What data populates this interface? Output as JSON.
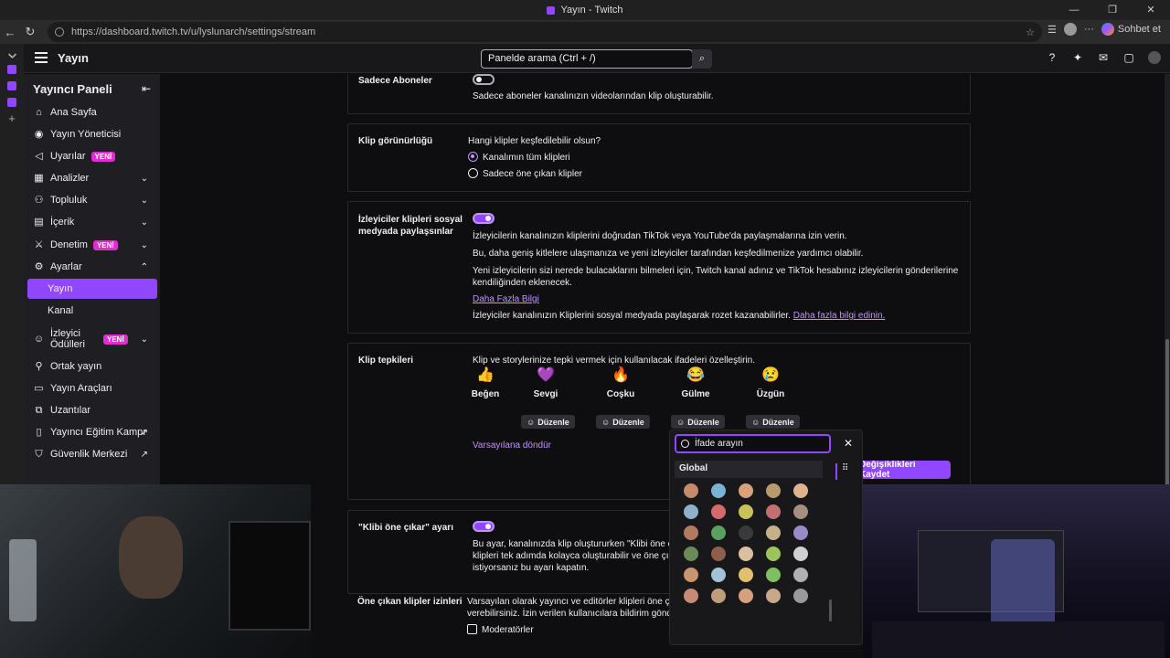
{
  "window": {
    "title": "Yayın - Twitch",
    "url": "https://dashboard.twitch.tv/u/lyslunarch/settings/stream",
    "chat_label": "Sohbet et"
  },
  "header": {
    "title": "Yayın",
    "search_placeholder": "Panelde arama (Ctrl + /)"
  },
  "sidebar": {
    "title": "Yayıncı Paneli",
    "items": [
      {
        "label": "Ana Sayfa"
      },
      {
        "label": "Yayın Yöneticisi"
      },
      {
        "label": "Uyarılar",
        "badge": "YENİ"
      },
      {
        "label": "Analizler"
      },
      {
        "label": "Topluluk"
      },
      {
        "label": "İçerik"
      },
      {
        "label": "Denetim",
        "badge": "YENİ"
      },
      {
        "label": "Ayarlar"
      },
      {
        "label": "Yayın"
      },
      {
        "label": "Kanal"
      },
      {
        "label": "İzleyici Ödülleri",
        "badge": "YENİ"
      },
      {
        "label": "Ortak yayın"
      },
      {
        "label": "Yayın Araçları"
      },
      {
        "label": "Uzantılar"
      },
      {
        "label": "Yayıncı Eğitim Kampı"
      },
      {
        "label": "Güvenlik Merkezi"
      }
    ]
  },
  "settings": {
    "subs": {
      "label": "Sadece Aboneler",
      "desc": "Sadece aboneler kanalınızın videolarından klip oluşturabilir."
    },
    "visibility": {
      "label": "Klip görünürlüğü",
      "question": "Hangi klipler keşfedilebilir olsun?",
      "opt1": "Kanalımın tüm klipleri",
      "opt2": "Sadece öne çıkan klipler"
    },
    "social": {
      "label": "İzleyiciler klipleri sosyal medyada paylaşsınlar",
      "p1": "İzleyicilerin kanalınızın kliplerini doğrudan TikTok veya YouTube'da paylaşmalarına izin verin.",
      "p2": "Bu, daha geniş kitlelere ulaşmanıza ve yeni izleyiciler tarafından keşfedilmenize yardımcı olabilir.",
      "p3a": "Yeni izleyicilerin sizi nerede bulacaklarını bilmeleri için, Twitch kanal adınız ve TikTok hesabınız izleyicilerin gönderilerine",
      "p3b": "kendiliğinden eklenecek.",
      "link": "Daha Fazla Bilgi",
      "p4": "İzleyiciler kanalınızın Kliplerini sosyal medyada paylaşarak rozet kazanabilirler.",
      "p4link": "Daha fazla bilgi edinin."
    },
    "reactions": {
      "label": "Klip tepkileri",
      "desc": "Klip ve storylerinize tepki vermek için kullanılacak ifadeleri özelleştirin.",
      "items": [
        {
          "name": "Beğen",
          "emo": "👍"
        },
        {
          "name": "Sevgi",
          "emo": "💜"
        },
        {
          "name": "Coşku",
          "emo": "🔥"
        },
        {
          "name": "Gülme",
          "emo": "😂"
        },
        {
          "name": "Üzgün",
          "emo": "😢"
        }
      ],
      "edit_label": "Düzenle",
      "reset": "Varsayılana döndür"
    },
    "feature": {
      "label": "\"Klibi öne çıkar\" ayarı",
      "p1": "Bu ayar, kanalınızda klip oluştururken \"Klibi öne ç",
      "p2": "klipleri tek adımda kolayca oluşturabilir ve öne çık",
      "p3": "istiyorsanız bu ayarı kapatın."
    },
    "perms": {
      "label": "Öne çıkan klipler izinleri",
      "p1": "Varsayılan olarak yayıncı ve editörler klipleri öne ç",
      "p2": "verebilirsiniz. İzin verilen kullanıcılara bildirim gönd",
      "opt": "Moderatörler"
    },
    "save": "Değişiklikleri Kaydet"
  },
  "picker": {
    "placeholder": "İfade arayın",
    "group": "Global"
  }
}
